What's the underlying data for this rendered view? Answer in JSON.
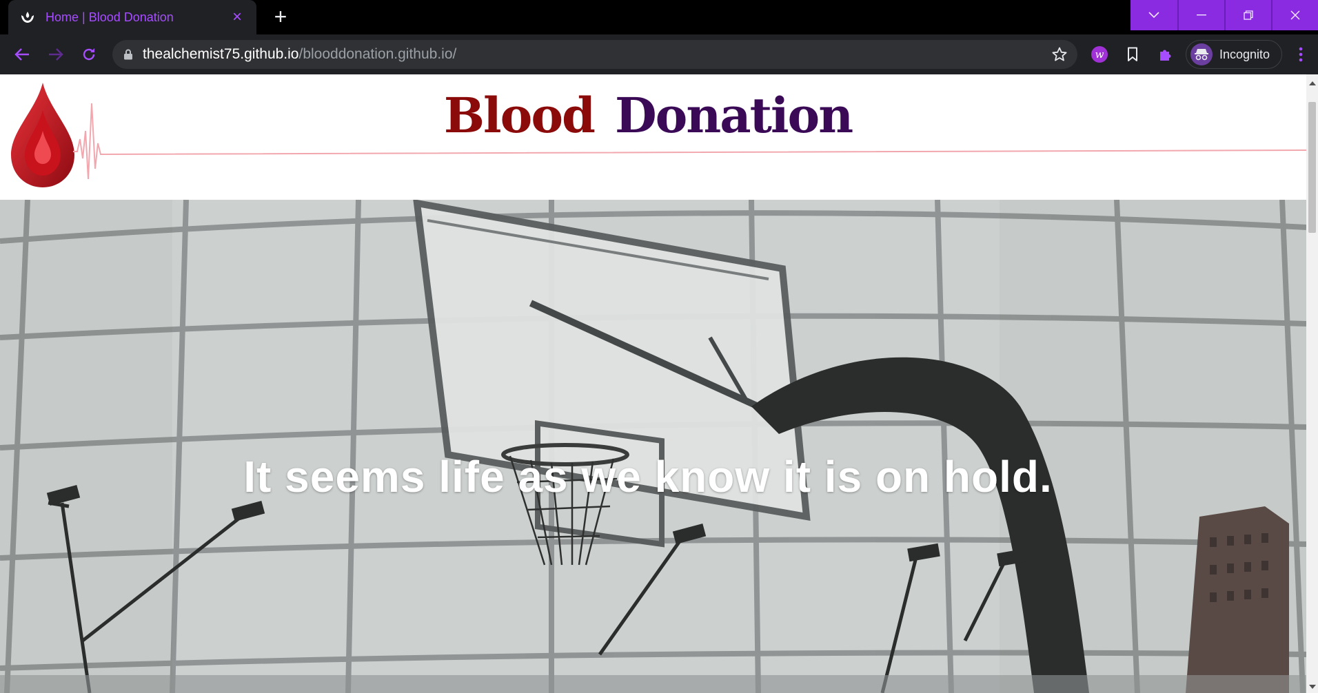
{
  "browser": {
    "tab": {
      "title": "Home | Blood Donation",
      "favicon": "hands-holding-drop-icon",
      "close_glyph": "×"
    },
    "new_tab_glyph": "+",
    "url": {
      "host": "thealchemist75.github.io",
      "path": "/blooddonation.github.io/"
    },
    "profile_label": "Incognito",
    "accent_color": "#8a2be2"
  },
  "page": {
    "title_word_1": "Blood",
    "title_word_2": "Donation",
    "title_colors": [
      "#8b0a0a",
      "#3b0a57"
    ],
    "hero_caption": "It seems life as we know it is on hold."
  }
}
